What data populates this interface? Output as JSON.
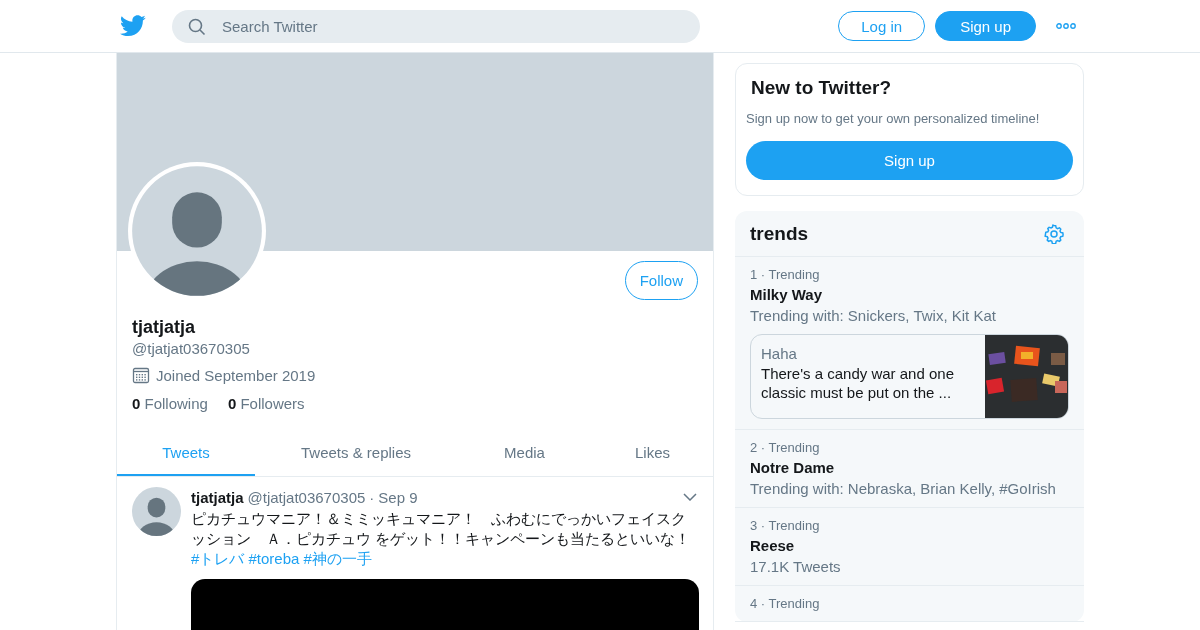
{
  "header": {
    "search": {
      "placeholder": "Search Twitter"
    },
    "buttons": [
      {
        "label": "Log in",
        "kind": "outline"
      },
      {
        "label": "Sign up",
        "kind": "filled"
      }
    ]
  },
  "profile": {
    "name": "tjatjatja",
    "handle": "@tjatjat03670305",
    "joined": "Joined September 2019",
    "stats": [
      {
        "count": "0",
        "label": "Following"
      },
      {
        "count": "0",
        "label": "Followers"
      }
    ],
    "follow_button": "Follow"
  },
  "tabs": [
    {
      "label": "Tweets",
      "selected": true
    },
    {
      "label": "Tweets & replies",
      "selected": false
    },
    {
      "label": "Media",
      "selected": false
    },
    {
      "label": "Likes",
      "selected": false
    }
  ],
  "tweet": {
    "name": "tjatjatja",
    "handle": "@tjatjat03670305",
    "separator": "·",
    "time": "Sep 9",
    "text": "ピカチュウマニア！＆ミミッキュマニア！　ふわむにでっかいフェイスクッション　Ａ．ピカチュウ をゲット！！キャンペーンも当たるといいな！",
    "hashtags": [
      "#トレバ",
      "#toreba",
      "#神の一手"
    ]
  },
  "signup_card": {
    "title": "New to Twitter?",
    "subtitle": "Sign up now to get your own personalized timeline!",
    "button": "Sign up"
  },
  "trends": {
    "title": "trends",
    "items": [
      {
        "meta": "1 · Trending",
        "name": "Milky Way",
        "detail": "Trending with: Snickers, Twix, Kit Kat",
        "card": {
          "source": "Haha",
          "text": "There's a candy war and one classic must be put on the ..."
        }
      },
      {
        "meta": "2 · Trending",
        "name": "Notre Dame",
        "detail": "Trending with: Nebraska, Brian Kelly, #GoIrish"
      },
      {
        "meta": "3 · Trending",
        "name": "Reese",
        "detail": "17.1K Tweets"
      },
      {
        "meta": "4 · Trending"
      }
    ]
  }
}
